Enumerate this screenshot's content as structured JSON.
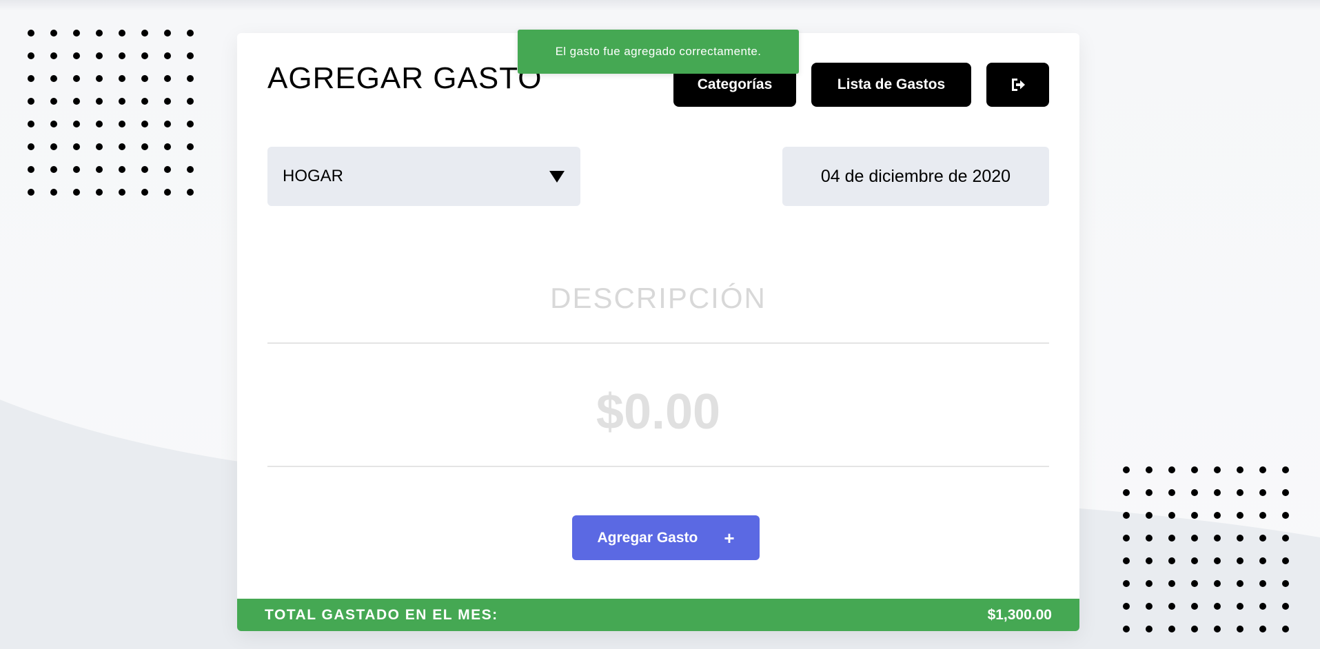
{
  "header": {
    "title": "AGREGAR GASTO",
    "categories_button": "Categorías",
    "expense_list_button": "Lista de Gastos",
    "logout_icon": "logout-icon"
  },
  "toast": {
    "message": "El gasto fue agregado correctamente."
  },
  "form": {
    "category": {
      "selected": "HOGAR",
      "icon": "caret-down-icon"
    },
    "date": "04 de diciembre de 2020",
    "description": {
      "placeholder": "DESCRIPCIÓN",
      "value": ""
    },
    "amount": {
      "placeholder": "$0.00",
      "value": ""
    },
    "submit_label": "Agregar Gasto",
    "submit_icon": "+"
  },
  "footer": {
    "total_label": "TOTAL GASTADO EN EL MES:",
    "total_value": "$1,300.00"
  },
  "colors": {
    "success_green": "#45a853",
    "primary_blue": "#5b69e3",
    "dark_button": "#000000",
    "input_bg": "#e8ebf1"
  }
}
